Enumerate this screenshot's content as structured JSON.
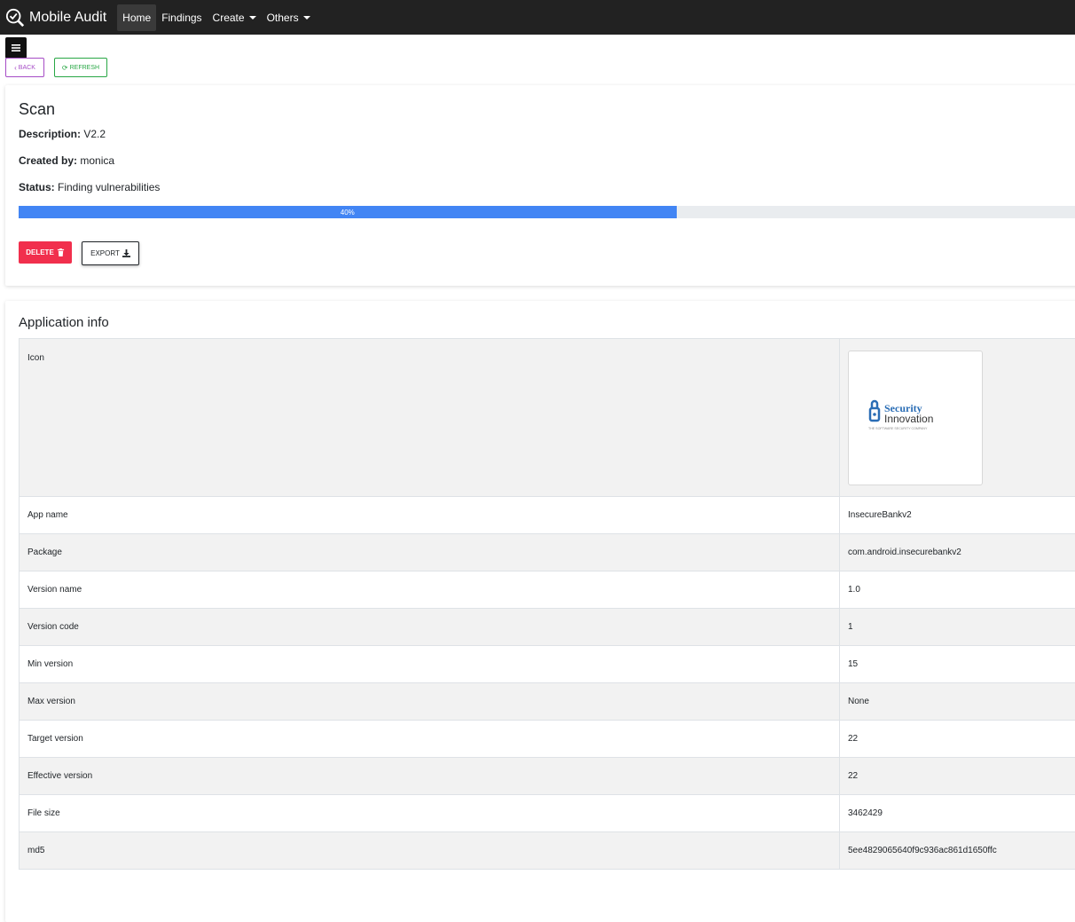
{
  "navbar": {
    "brand": "Mobile Audit",
    "brand_icon": "check-magnifier-icon",
    "items": [
      {
        "label": "Home",
        "active": true,
        "dropdown": false
      },
      {
        "label": "Findings",
        "active": false,
        "dropdown": false
      },
      {
        "label": "Create",
        "active": false,
        "dropdown": true
      },
      {
        "label": "Others",
        "active": false,
        "dropdown": true
      }
    ]
  },
  "sidebar_toggle_icon": "hamburger-icon",
  "buttons": {
    "back": "BACK",
    "refresh": "REFRESH",
    "delete": "DELETE",
    "export": "EXPORT"
  },
  "scan": {
    "title": "Scan",
    "description_label": "Description:",
    "description": "V2.2",
    "created_by_label": "Created by:",
    "created_by": "monica",
    "status_label": "Status:",
    "status": "Finding vulnerabilities",
    "progress": 40,
    "progress_label": "40%"
  },
  "app_info": {
    "title": "Application info",
    "icon_label": "Icon",
    "icon_image": {
      "name": "security-innovation-logo",
      "text_line1": "Security",
      "text_line2": "Innovation",
      "tagline": "THE SOFTWARE SECURITY COMPANY"
    },
    "rows": [
      {
        "key": "App name",
        "value": "InsecureBankv2"
      },
      {
        "key": "Package",
        "value": "com.android.insecurebankv2"
      },
      {
        "key": "Version name",
        "value": "1.0"
      },
      {
        "key": "Version code",
        "value": "1"
      },
      {
        "key": "Min version",
        "value": "15"
      },
      {
        "key": "Max version",
        "value": "None"
      },
      {
        "key": "Target version",
        "value": "22"
      },
      {
        "key": "Effective version",
        "value": "22"
      },
      {
        "key": "File size",
        "value": "3462429"
      },
      {
        "key": "md5",
        "value": "5ee4829065640f9c936ac861d1650ffc"
      }
    ]
  },
  "colors": {
    "navbar": "#222222",
    "progress": "#4285f4",
    "delete": "#f12f4d",
    "back": "#a64cc6",
    "refresh": "#28a745"
  }
}
